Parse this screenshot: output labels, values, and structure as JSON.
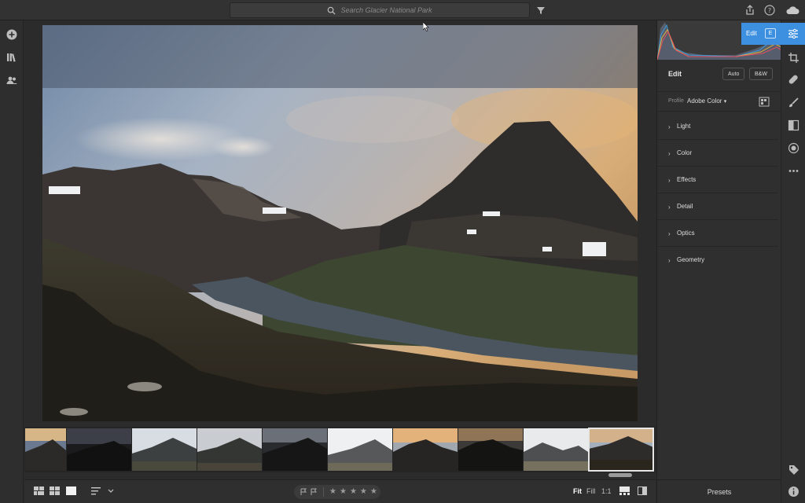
{
  "search": {
    "placeholder": "Search Glacier National Park"
  },
  "edit_panel": {
    "tab_label": "Edit",
    "tab_shortcut": "E",
    "title": "Edit",
    "auto_label": "Auto",
    "bw_label": "B&W",
    "profile_label": "Profile",
    "profile_value": "Adobe Color",
    "sections": [
      {
        "label": "Light"
      },
      {
        "label": "Color"
      },
      {
        "label": "Effects"
      },
      {
        "label": "Detail"
      },
      {
        "label": "Optics"
      },
      {
        "label": "Geometry"
      }
    ],
    "presets_label": "Presets"
  },
  "bottombar": {
    "view_fit": "Fit",
    "view_fill": "Fill",
    "view_1to1": "1:1",
    "stars": [
      "★",
      "★",
      "★",
      "★",
      "★"
    ]
  },
  "filmstrip": {
    "selected_index": 9,
    "count": 10
  },
  "colors": {
    "accent": "#3d8fe0",
    "background": "#2b2b2b",
    "panel": "#2f2f2f"
  }
}
